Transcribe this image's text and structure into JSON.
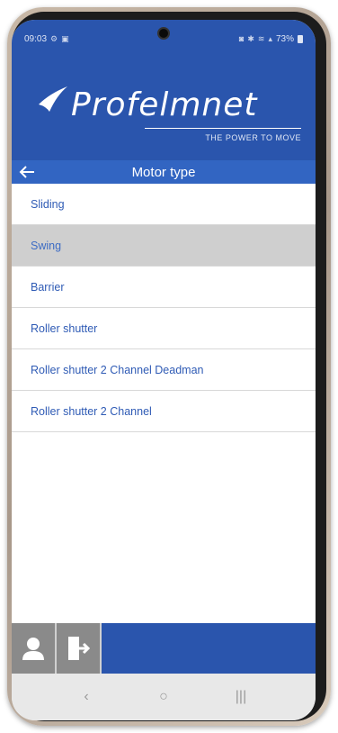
{
  "status_bar": {
    "time": "09:03",
    "battery_percent": "73%",
    "icons_left": [
      "settings-icon",
      "image-icon"
    ],
    "icons_right": [
      "nfc-icon",
      "bluetooth-icon",
      "wifi-icon",
      "signal-icon",
      "battery-icon"
    ]
  },
  "brand": {
    "name": "Profelmnet",
    "tagline": "THE POWER TO MOVE"
  },
  "nav": {
    "title": "Motor type"
  },
  "motor_types": [
    {
      "label": "Sliding",
      "selected": false
    },
    {
      "label": "Swing",
      "selected": true
    },
    {
      "label": "Barrier",
      "selected": false
    },
    {
      "label": "Roller shutter",
      "selected": false
    },
    {
      "label": "Roller shutter 2 Channel Deadman",
      "selected": false
    },
    {
      "label": "Roller shutter 2 Channel",
      "selected": false
    }
  ],
  "bottom_bar": {
    "buttons": [
      "user-icon",
      "exit-icon"
    ]
  },
  "android_nav": {
    "back": "‹",
    "home": "○",
    "recents": "|||"
  },
  "colors": {
    "primary": "#2a55ad",
    "nav": "#3265c2",
    "item_text": "#2f5bb5",
    "selected_bg": "#cfcfcf"
  }
}
